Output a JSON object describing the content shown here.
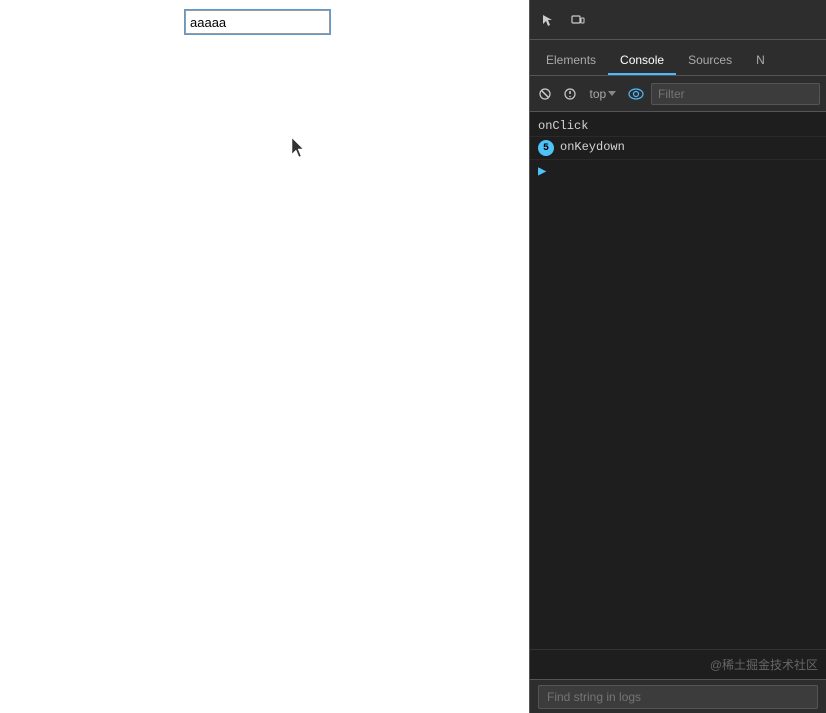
{
  "browser": {
    "input_value": "aaaaa"
  },
  "devtools": {
    "tabs": [
      {
        "label": "Elements",
        "active": false
      },
      {
        "label": "Console",
        "active": true
      },
      {
        "label": "Sources",
        "active": false
      },
      {
        "label": "N",
        "active": false
      }
    ],
    "toolbar": {
      "top_label": "top",
      "filter_placeholder": "Filter"
    },
    "console_entries": [
      {
        "type": "text",
        "text": "onClick"
      },
      {
        "type": "badge",
        "badge": "5",
        "text": "onKeydown"
      }
    ],
    "watermark": "@稀土掘金技术社区",
    "find_placeholder": "Find string in logs"
  }
}
